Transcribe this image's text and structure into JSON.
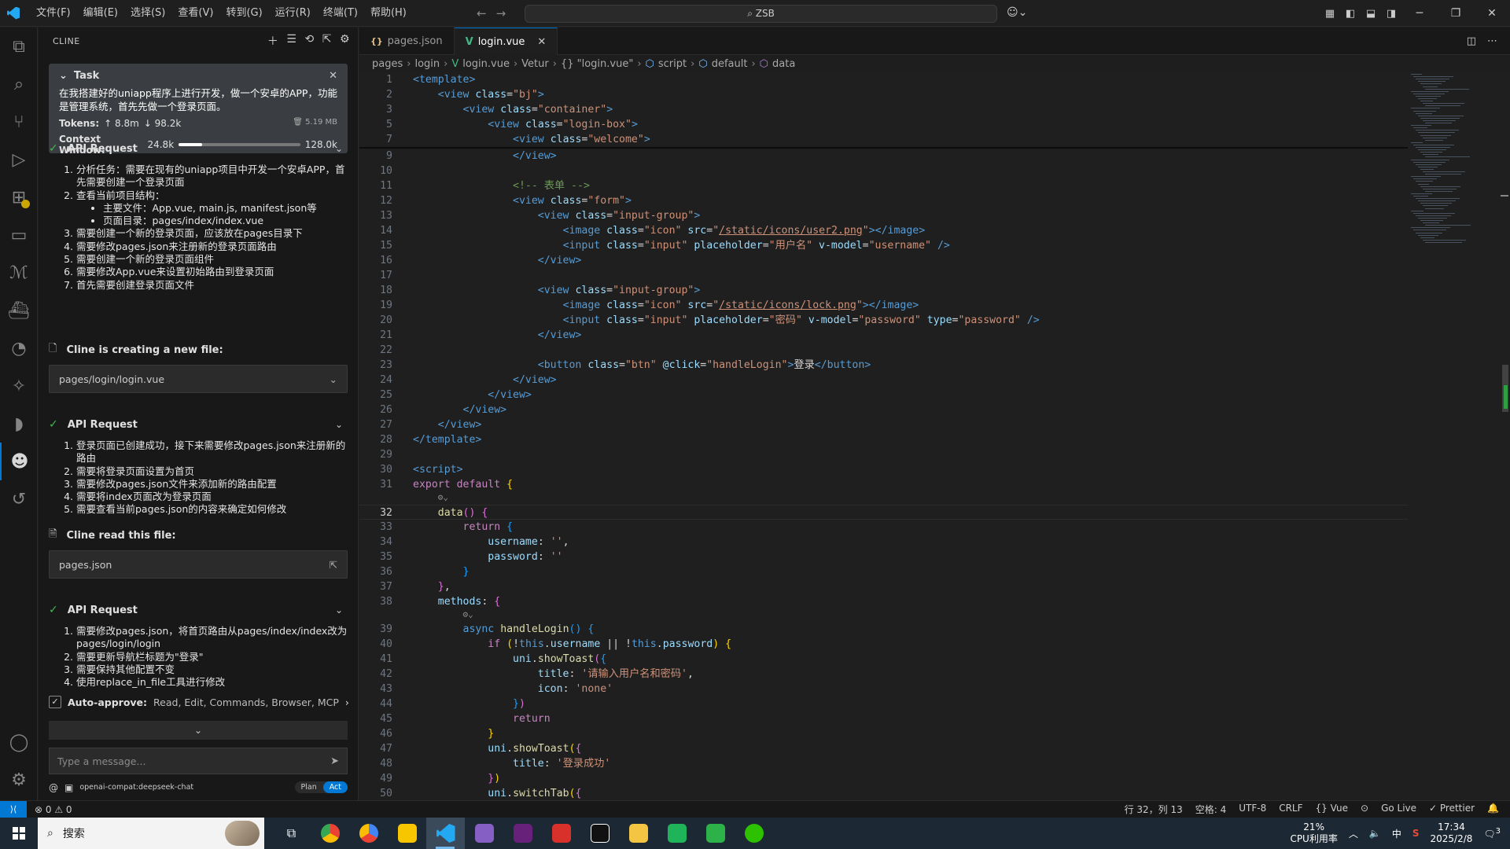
{
  "menu": [
    "文件(F)",
    "编辑(E)",
    "选择(S)",
    "查看(V)",
    "转到(G)",
    "运行(R)",
    "终端(T)",
    "帮助(H)"
  ],
  "search": {
    "text": "ZSB"
  },
  "side": {
    "title": "CLINE",
    "task": {
      "title": "Task",
      "text": "在我搭建好的uniapp程序上进行开发，做一个安卓的APP，功能是管理系统，首先先做一个登录页面。",
      "tokens_label": "Tokens:",
      "tokens_up": "↑ 8.8m",
      "tokens_down": "↓ 98.2k",
      "size": "5.19 MB",
      "ctx_label": "Context Window:",
      "ctx_used": "24.8k",
      "ctx_total": "128.0k",
      "ctx_fraction": 0.19
    },
    "api1": {
      "title": "API Request",
      "items": [
        "分析任务：需要在现有的uniapp项目中开发一个安卓APP，首先需要创建一个登录页面",
        "查看当前项目结构：",
        "需要创建一个新的登录页面，应该放在pages目录下",
        "需要修改pages.json来注册新的登录页面路由",
        "需要创建一个新的登录页面组件",
        "需要修改App.vue来设置初始路由到登录页面",
        "首先需要创建登录页面文件"
      ],
      "sub": [
        "主要文件：App.vue, main.js, manifest.json等",
        "页面目录：pages/index/index.vue"
      ]
    },
    "newfile": {
      "title": "Cline is creating a new file:",
      "path": "pages/login/login.vue"
    },
    "api2": {
      "title": "API Request",
      "items": [
        "登录页面已创建成功，接下来需要修改pages.json来注册新的路由",
        "需要将登录页面设置为首页",
        "需要修改pages.json文件来添加新的路由配置",
        "需要将index页面改为登录页面",
        "需要查看当前pages.json的内容来确定如何修改"
      ]
    },
    "readfile": {
      "title": "Cline read this file:",
      "path": "pages.json"
    },
    "api3": {
      "title": "API Request",
      "items": [
        "需要修改pages.json，将首页路由从pages/index/index改为pages/login/login",
        "需要更新导航栏标题为\"登录\"",
        "需要保持其他配置不变",
        "使用replace_in_file工具进行修改"
      ]
    },
    "auto_approve_label": "Auto-approve:",
    "auto_approve_items": "Read, Edit, Commands, Browser, MCP",
    "input_placeholder": "Type a message...",
    "model": "openai-compat:deepseek-chat",
    "plan": "Plan",
    "act": "Act"
  },
  "tabs": [
    {
      "label": "pages.json"
    },
    {
      "label": "login.vue"
    }
  ],
  "breadcrumb": [
    "pages",
    "login",
    "login.vue",
    "Vetur",
    "{} \"login.vue\"",
    "script",
    "default",
    "data"
  ],
  "code": [
    {
      "n": "1",
      "h": "<span class='tag'>&lt;template&gt;</span>"
    },
    {
      "n": "2",
      "h": "    <span class='tag'>&lt;view</span> <span class='attr'>class</span>=<span class='str'>\"bj\"</span><span class='tag'>&gt;</span>"
    },
    {
      "n": "3",
      "h": "        <span class='tag'>&lt;view</span> <span class='attr'>class</span>=<span class='str'>\"container\"</span><span class='tag'>&gt;</span>"
    },
    {
      "n": "5",
      "h": "            <span class='tag'>&lt;view</span> <span class='attr'>class</span>=<span class='str'>\"login-box\"</span><span class='tag'>&gt;</span>"
    },
    {
      "n": "7",
      "h": "                <span class='tag'>&lt;view</span> <span class='attr'>class</span>=<span class='str'>\"welcome\"</span><span class='tag'>&gt;</span>"
    },
    {
      "n": "9",
      "h": "                <span class='tag'>&lt;/view&gt;</span>"
    },
    {
      "n": "10",
      "h": ""
    },
    {
      "n": "11",
      "h": "                <span class='cm'>&lt;!-- 表单 --&gt;</span>"
    },
    {
      "n": "12",
      "h": "                <span class='tag'>&lt;view</span> <span class='attr'>class</span>=<span class='str'>\"form\"</span><span class='tag'>&gt;</span>"
    },
    {
      "n": "13",
      "h": "                    <span class='tag'>&lt;view</span> <span class='attr'>class</span>=<span class='str'>\"input-group\"</span><span class='tag'>&gt;</span>"
    },
    {
      "n": "14",
      "h": "                        <span class='tag'>&lt;image</span> <span class='attr'>class</span>=<span class='str'>\"icon\"</span> <span class='attr'>src</span>=<span class='str'>\"<span class='und'>/static/icons/user2.png</span>\"</span><span class='tag'>&gt;&lt;/image&gt;</span>"
    },
    {
      "n": "15",
      "h": "                        <span class='tag'>&lt;input</span> <span class='attr'>class</span>=<span class='str'>\"input\"</span> <span class='attr'>placeholder</span>=<span class='str'>\"用户名\"</span> <span class='attr'>v-model</span>=<span class='str'>\"username\"</span> <span class='tag'>/&gt;</span>"
    },
    {
      "n": "16",
      "h": "                    <span class='tag'>&lt;/view&gt;</span>"
    },
    {
      "n": "17",
      "h": ""
    },
    {
      "n": "18",
      "h": "                    <span class='tag'>&lt;view</span> <span class='attr'>class</span>=<span class='str'>\"input-group\"</span><span class='tag'>&gt;</span>"
    },
    {
      "n": "19",
      "h": "                        <span class='tag'>&lt;image</span> <span class='attr'>class</span>=<span class='str'>\"icon\"</span> <span class='attr'>src</span>=<span class='str'>\"<span class='und'>/static/icons/lock.png</span>\"</span><span class='tag'>&gt;&lt;/image&gt;</span>"
    },
    {
      "n": "20",
      "h": "                        <span class='tag'>&lt;input</span> <span class='attr'>class</span>=<span class='str'>\"input\"</span> <span class='attr'>placeholder</span>=<span class='str'>\"密码\"</span> <span class='attr'>v-model</span>=<span class='str'>\"password\"</span> <span class='attr'>type</span>=<span class='str'>\"password\"</span> <span class='tag'>/&gt;</span>"
    },
    {
      "n": "21",
      "h": "                    <span class='tag'>&lt;/view&gt;</span>"
    },
    {
      "n": "22",
      "h": ""
    },
    {
      "n": "23",
      "h": "                    <span class='tag'>&lt;button</span> <span class='attr'>class</span>=<span class='str'>\"btn\"</span> <span class='attr'>@click</span>=<span class='str'>\"handleLogin\"</span><span class='tag'>&gt;</span>登录<span class='tag'>&lt;/button&gt;</span>"
    },
    {
      "n": "24",
      "h": "                <span class='tag'>&lt;/view&gt;</span>"
    },
    {
      "n": "25",
      "h": "            <span class='tag'>&lt;/view&gt;</span>"
    },
    {
      "n": "26",
      "h": "        <span class='tag'>&lt;/view&gt;</span>"
    },
    {
      "n": "27",
      "h": "    <span class='tag'>&lt;/view&gt;</span>"
    },
    {
      "n": "28",
      "h": "<span class='tag'>&lt;/template&gt;</span>"
    },
    {
      "n": "29",
      "h": ""
    },
    {
      "n": "30",
      "h": "<span class='tag'>&lt;script&gt;</span>"
    },
    {
      "n": "31",
      "h": "<span class='kw'>export</span> <span class='kw'>default</span> <span class='br1'>{</span>"
    },
    {
      "n": "",
      "h": "    <span class='hint'>⚙⌄</span>"
    },
    {
      "n": "32",
      "h": "    <span class='fn'>data</span><span class='br2'>()</span> <span class='br2'>{</span>",
      "cur": true
    },
    {
      "n": "33",
      "h": "        <span class='kw'>return</span> <span class='br3'>{</span>"
    },
    {
      "n": "34",
      "h": "            <span class='prop'>username</span>: <span class='str'>''</span>,"
    },
    {
      "n": "35",
      "h": "            <span class='prop'>password</span>: <span class='str'>''</span>"
    },
    {
      "n": "36",
      "h": "        <span class='br3'>}</span>"
    },
    {
      "n": "37",
      "h": "    <span class='br2'>}</span>,"
    },
    {
      "n": "38",
      "h": "    <span class='prop'>methods</span>: <span class='br2'>{</span>"
    },
    {
      "n": "",
      "h": "        <span class='hint'>⚙⌄</span>"
    },
    {
      "n": "39",
      "h": "        <span class='kw2'>async</span> <span class='fn'>handleLogin</span><span class='br3'>()</span> <span class='br3'>{</span>"
    },
    {
      "n": "40",
      "h": "            <span class='kw'>if</span> <span class='br1'>(</span>!<span class='kw2'>this</span>.<span class='prop'>username</span> || !<span class='kw2'>this</span>.<span class='prop'>password</span><span class='br1'>)</span> <span class='br1'>{</span>"
    },
    {
      "n": "41",
      "h": "                <span class='prop'>uni</span>.<span class='fn'>showToast</span><span class='br2'>(</span><span class='br3'>{</span>"
    },
    {
      "n": "42",
      "h": "                    <span class='prop'>title</span>: <span class='str'>'请输入用户名和密码'</span>,"
    },
    {
      "n": "43",
      "h": "                    <span class='prop'>icon</span>: <span class='str'>'none'</span>"
    },
    {
      "n": "44",
      "h": "                <span class='br3'>}</span><span class='br2'>)</span>"
    },
    {
      "n": "45",
      "h": "                <span class='kw'>return</span>"
    },
    {
      "n": "46",
      "h": "            <span class='br1'>}</span>"
    },
    {
      "n": "47",
      "h": "            <span class='prop'>uni</span>.<span class='fn'>showToast</span><span class='br1'>(</span><span class='br2'>{</span>"
    },
    {
      "n": "48",
      "h": "                <span class='prop'>title</span>: <span class='str'>'登录成功'</span>"
    },
    {
      "n": "49",
      "h": "            <span class='br2'>}</span><span class='br1'>)</span>"
    },
    {
      "n": "50",
      "h": "            <span class='prop'>uni</span>.<span class='fn'>switchTab</span><span class='br1'>(</span><span class='br2'>{</span>"
    }
  ],
  "status": {
    "problems": "⊗ 0 ⚠ 0",
    "right": [
      "行 32，列 13",
      "空格: 4",
      "UTF-8",
      "CRLF",
      "{} Vue",
      "⊙",
      "Go Live",
      "✓ Prettier",
      "🔔"
    ]
  },
  "taskbar": {
    "search": "搜索",
    "cpu": "21%",
    "cpu_label": "CPU利用率",
    "ime": "中",
    "time": "17:34",
    "date": "2025/2/8",
    "notif": "3"
  }
}
